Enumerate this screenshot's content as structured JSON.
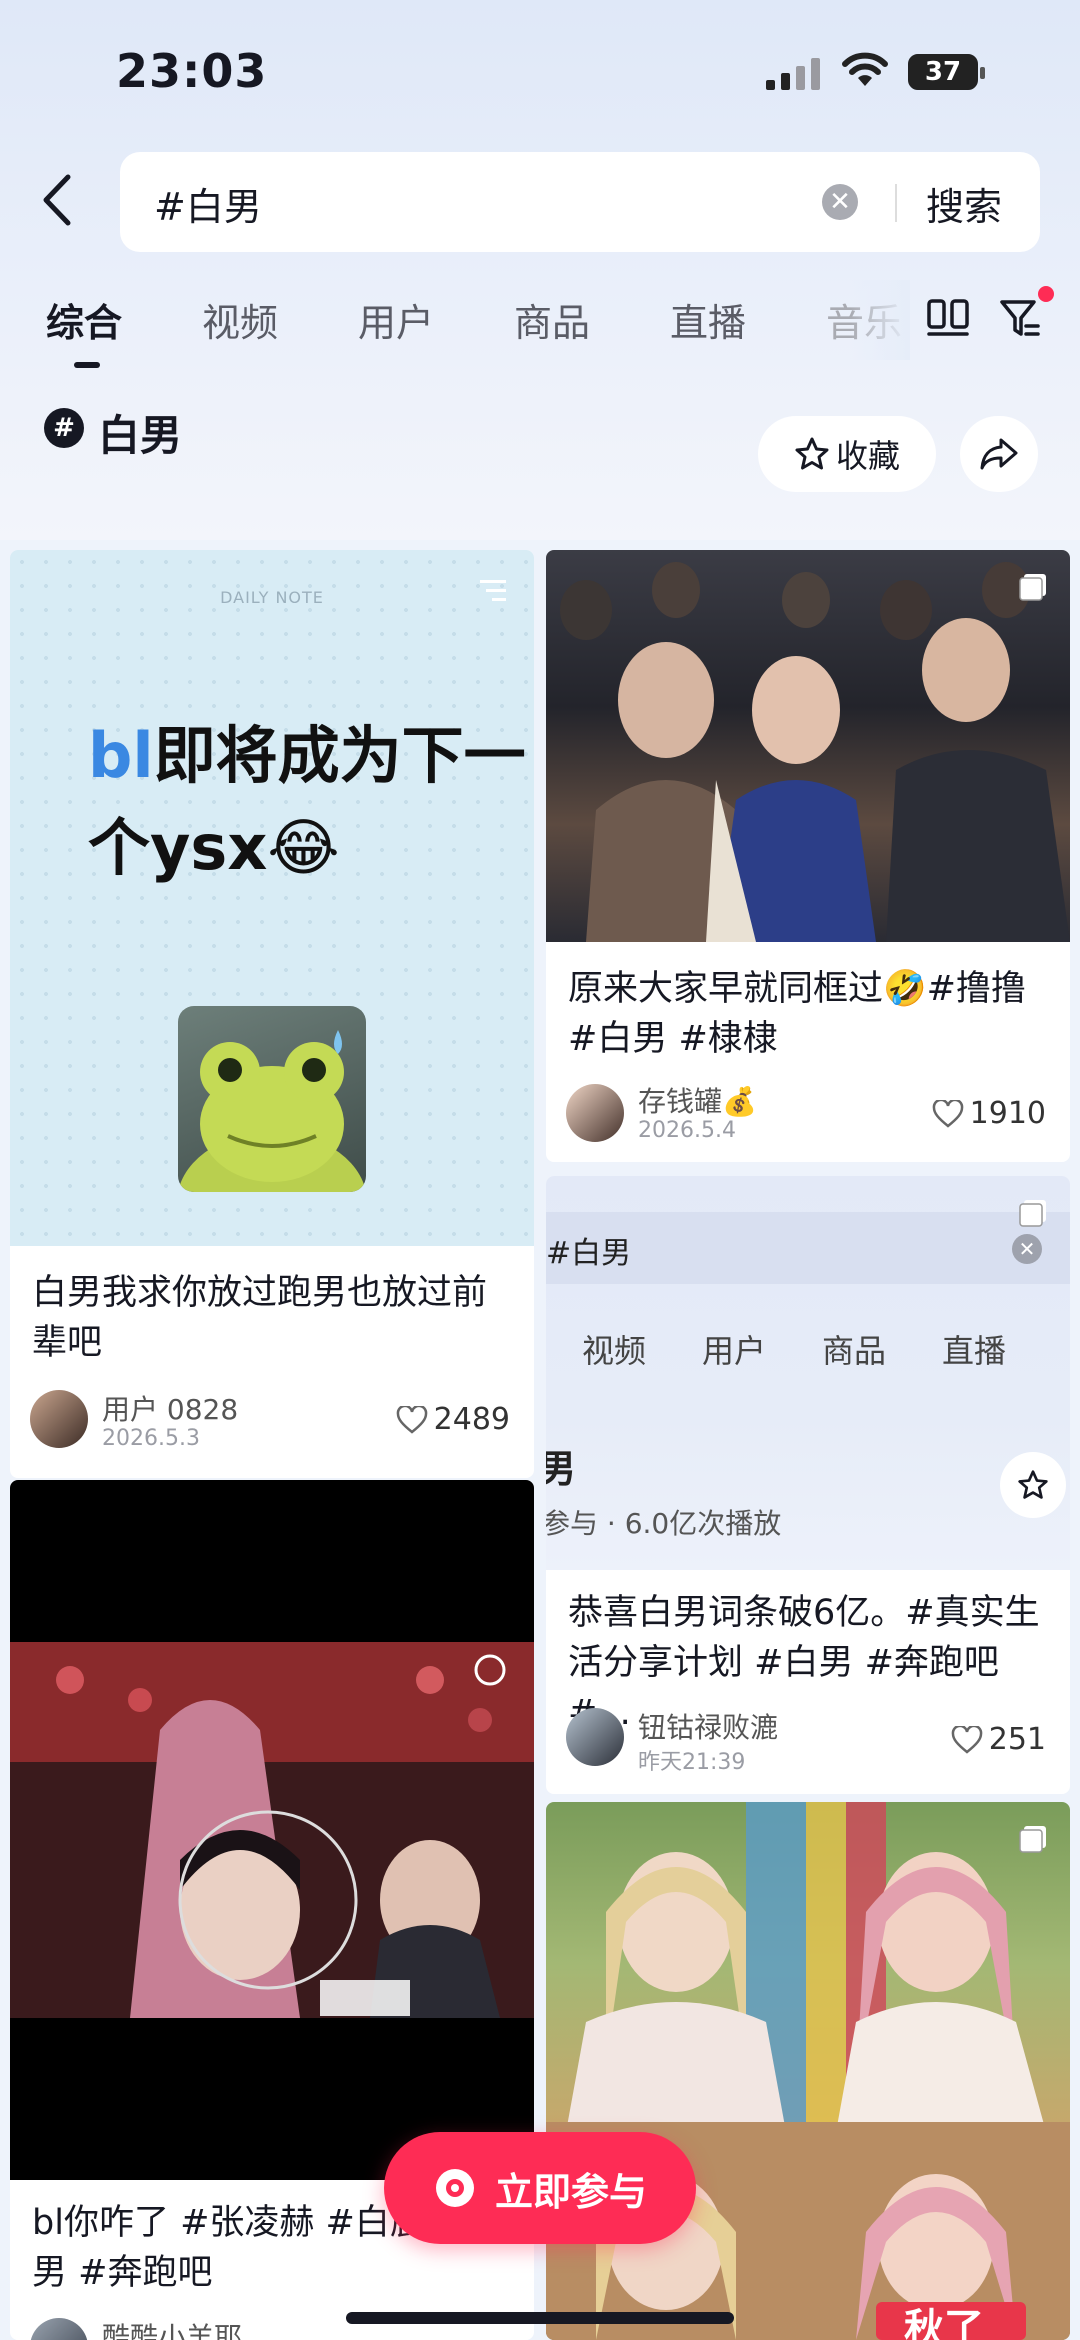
{
  "status_bar": {
    "time": "23:03",
    "battery": "37"
  },
  "search": {
    "query": "#白男",
    "submit_label": "搜索"
  },
  "tabs": [
    {
      "label": "综合",
      "active": true
    },
    {
      "label": "视频"
    },
    {
      "label": "用户"
    },
    {
      "label": "商品"
    },
    {
      "label": "直播"
    },
    {
      "label": "音乐"
    }
  ],
  "topic": {
    "badge": "#",
    "title": "白男",
    "collect_label": "收藏"
  },
  "feed": {
    "left": [
      {
        "thumb_header": "DAILY NOTE",
        "thumb_text_accent": "bl",
        "thumb_text": "即将成为下一个ysx😂",
        "title": "白男我求你放过跑男也放过前辈吧",
        "author": "用户 0828",
        "date": "2026.5.3",
        "likes": "2489"
      },
      {
        "title": "bl你咋了 #张凌赫 #白鹿 #白男 #奔跑吧",
        "author": "酷酷小羊耶"
      }
    ],
    "right": [
      {
        "title": "原来大家早就同框过🤣#撸撸 #白男 #棣棣",
        "author": "存钱罐💰",
        "date": "2026.5.4",
        "likes": "1910"
      },
      {
        "thumb_search": "#白男",
        "thumb_tabs": [
          "视频",
          "用户",
          "商品",
          "直播"
        ],
        "thumb_topic_char": "男",
        "thumb_stats": "参与 · 6.0亿次播放",
        "title": "恭喜白男词条破6亿。#真实生活分享计划 #白男 #奔跑吧 #...",
        "author": "钮钴禄败漉",
        "date": "昨天21:39",
        "likes": "251"
      },
      {
        "thumb_caption": "秋了"
      }
    ]
  },
  "join_button": {
    "label": "立即参与"
  },
  "colors": {
    "accent": "#fe2c55",
    "bl_blue": "#3a88e2"
  }
}
